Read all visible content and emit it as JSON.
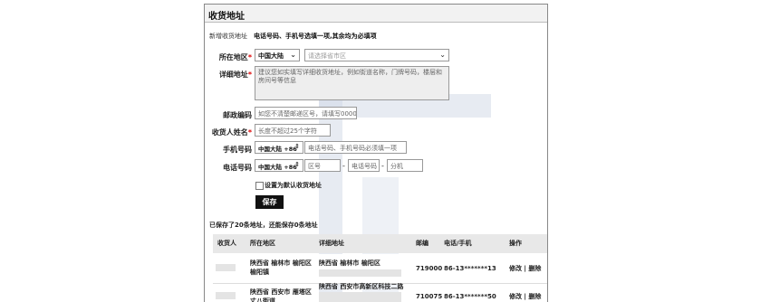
{
  "header": {
    "title": "收货地址"
  },
  "form": {
    "section_label": "新增收货地址",
    "section_note": "电话号码、手机号选填一项,其余均为必填项",
    "region": {
      "label": "所在地区",
      "country": "中国大陆",
      "province_placeholder": "请选择省市区"
    },
    "detail": {
      "label": "详细地址",
      "placeholder": "建议您如实填写详细收货地址，例如街道名称，门牌号码，楼层和房间号等信息"
    },
    "postcode": {
      "label": "邮政编码",
      "placeholder": "如您不清楚邮递区号，请填写000000"
    },
    "name": {
      "label": "收货人姓名",
      "placeholder": "长度不超过25个字符"
    },
    "mobile": {
      "label": "手机号码",
      "code": "中国大陆 +86",
      "placeholder": "电话号码、手机号码必须填一项"
    },
    "phone": {
      "label": "电话号码",
      "code": "中国大陆 +86",
      "area_placeholder": "区号",
      "number_placeholder": "电话号码",
      "ext_placeholder": "分机"
    },
    "default_label": "设置为默认收货地址",
    "save_label": "保存",
    "required_mark": "*",
    "dash": "-"
  },
  "saved_summary": "已保存了20条地址，还能保存0条地址",
  "table": {
    "headers": [
      "收货人",
      "所在地区",
      "详细地址",
      "邮编",
      "电话/手机",
      "操作"
    ],
    "rows": [
      {
        "region": "陕西省 榆林市 榆阳区 榆阳镇",
        "detail": "陕西省 榆林市 榆阳区",
        "postcode": "719000",
        "phone": "86-13*******13",
        "actions": "修改 | 删除"
      },
      {
        "region": "陕西省 西安市 雁塔区 丈八街道",
        "detail": "陕西省 西安市高新区科技二路",
        "postcode": "710075",
        "phone": "86-13*******50",
        "actions": "修改 | 删除"
      }
    ]
  }
}
